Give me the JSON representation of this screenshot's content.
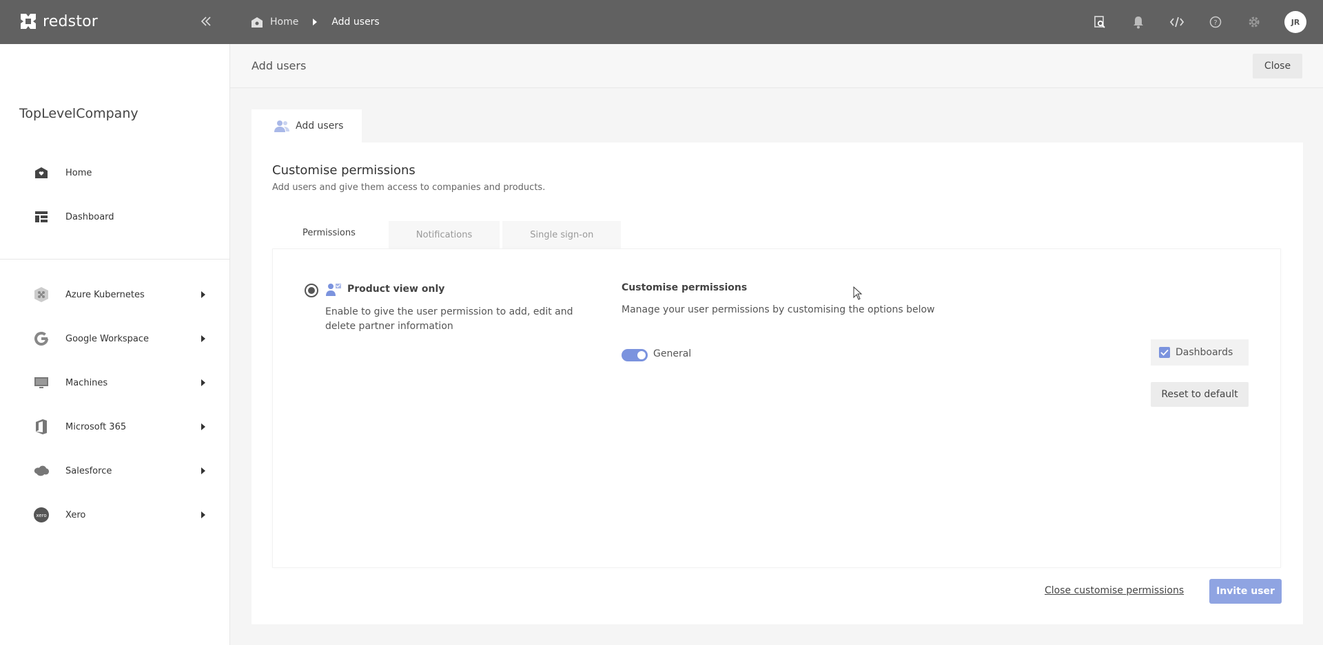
{
  "app": {
    "brand": "redstor"
  },
  "breadcrumb": {
    "home": "Home",
    "current": "Add users"
  },
  "topbar": {
    "icons": [
      "search-document-icon",
      "bell-icon",
      "code-icon",
      "help-icon",
      "gear-icon"
    ],
    "avatar_initials": "JR"
  },
  "sidebar": {
    "company": "TopLevelCompany",
    "items": [
      {
        "label": "Home",
        "icon": "home-icon"
      },
      {
        "label": "Dashboard",
        "icon": "dashboard-icon"
      },
      {
        "label": "Azure Kubernetes",
        "icon": "kubernetes-icon"
      },
      {
        "label": "Google Workspace",
        "icon": "google-icon"
      },
      {
        "label": "Machines",
        "icon": "monitor-icon"
      },
      {
        "label": "Microsoft 365",
        "icon": "office-icon"
      },
      {
        "label": "Salesforce",
        "icon": "salesforce-icon"
      },
      {
        "label": "Xero",
        "icon": "xero-icon"
      }
    ]
  },
  "header": {
    "title": "Add users",
    "close_label": "Close"
  },
  "outer_tab": {
    "label": "Add users"
  },
  "card": {
    "title": "Customise permissions",
    "subtitle": "Add users and give them access to companies and products.",
    "tabs": [
      {
        "label": "Permissions",
        "active": true
      },
      {
        "label": "Notifications",
        "active": false
      },
      {
        "label": "Single sign-on",
        "active": false
      }
    ],
    "option": {
      "title": "Product view only",
      "description": "Enable to give the user permission to add, edit and delete partner information"
    },
    "customise": {
      "title": "Customise permissions",
      "description": "Manage your user permissions by customising the options below",
      "toggle_label": "General",
      "checkbox_label": "Dashboards",
      "reset_label": "Reset to default"
    },
    "footer": {
      "close_link": "Close customise permissions",
      "invite_label": "Invite user"
    }
  },
  "colors": {
    "topbar": "#616161",
    "accent": "#7b93de",
    "invite": "#8fa4e2"
  }
}
